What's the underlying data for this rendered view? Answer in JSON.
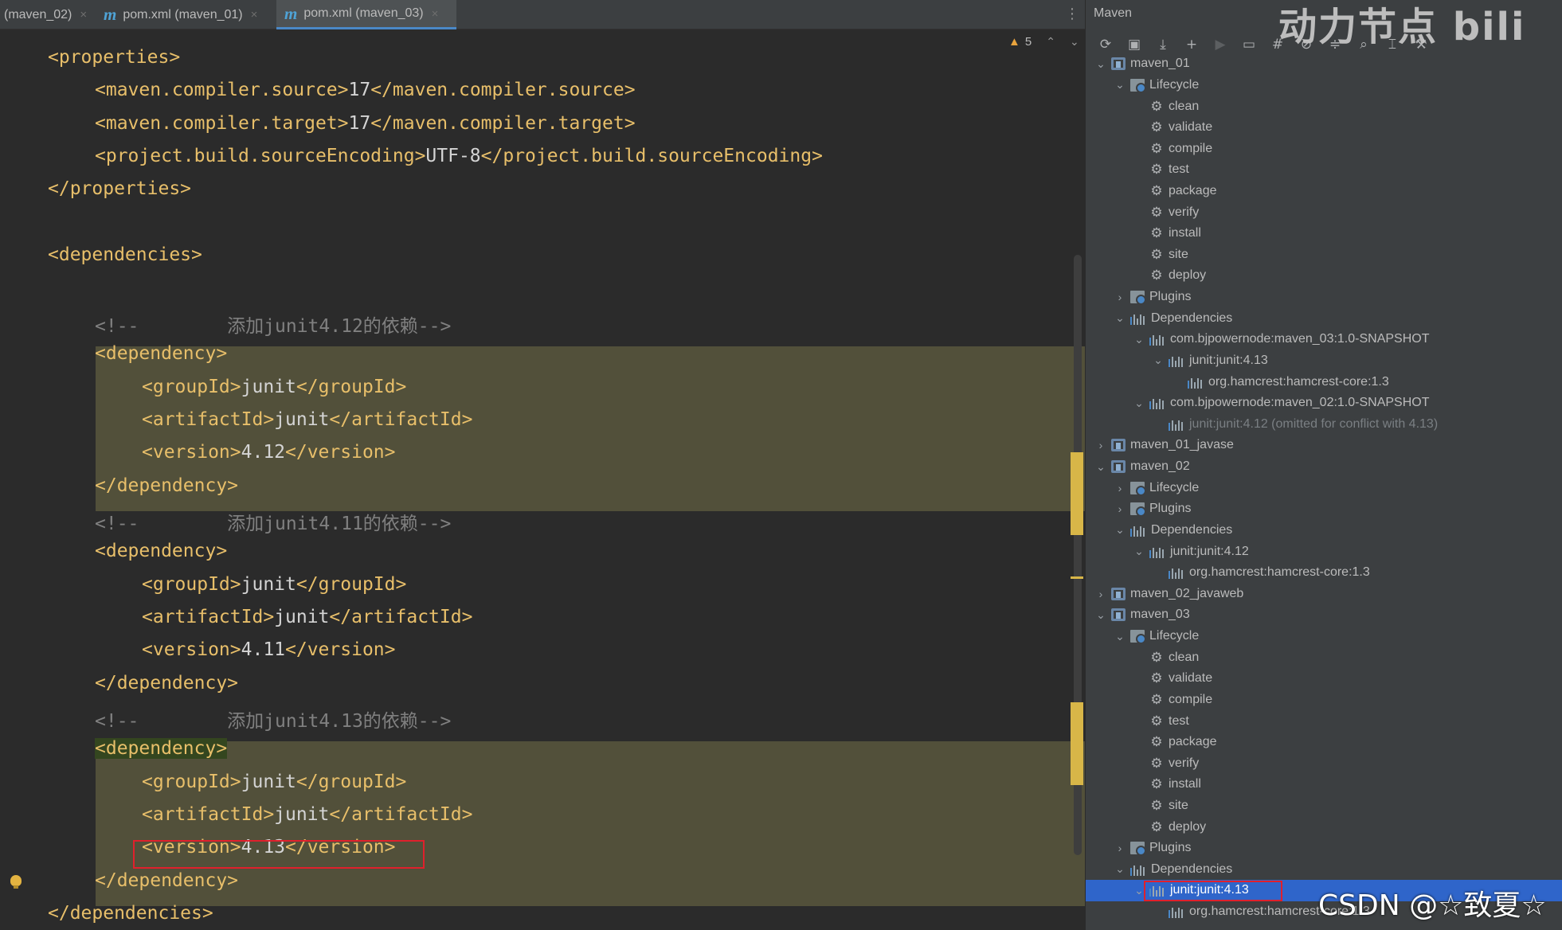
{
  "tabs": [
    {
      "label": "(maven_02)",
      "icon": "",
      "close": "×",
      "active": false
    },
    {
      "label": "pom.xml (maven_01)",
      "icon": "m",
      "close": "×",
      "active": false
    },
    {
      "label": "pom.xml (maven_03)",
      "icon": "m",
      "close": "×",
      "active": true
    }
  ],
  "editor": {
    "warnings_count": "5",
    "lines": [
      [
        {
          "t": "tag",
          "s": "<properties>"
        }
      ],
      [
        {
          "t": "tag",
          "s": "<maven.compiler.source>"
        },
        {
          "t": "txt",
          "s": "17"
        },
        {
          "t": "tag",
          "s": "</maven.compiler.source>"
        }
      ],
      [
        {
          "t": "tag",
          "s": "<maven.compiler.target>"
        },
        {
          "t": "txt",
          "s": "17"
        },
        {
          "t": "tag",
          "s": "</maven.compiler.target>"
        }
      ],
      [
        {
          "t": "tag",
          "s": "<project.build.sourceEncoding>"
        },
        {
          "t": "txt",
          "s": "UTF-8"
        },
        {
          "t": "tag",
          "s": "</project.build.sourceEncoding>"
        }
      ],
      [
        {
          "t": "tag",
          "s": "</properties>"
        }
      ],
      [],
      [
        {
          "t": "tag",
          "s": "<dependencies>"
        }
      ],
      [],
      [
        {
          "t": "cmt",
          "s": "<!--        添加junit4.12的依赖-->"
        }
      ],
      [
        {
          "t": "tag",
          "s": "<dependency>"
        }
      ],
      [
        {
          "t": "tag",
          "s": "<groupId>"
        },
        {
          "t": "txt",
          "s": "junit"
        },
        {
          "t": "tag",
          "s": "</groupId>"
        }
      ],
      [
        {
          "t": "tag",
          "s": "<artifactId>"
        },
        {
          "t": "txt",
          "s": "junit"
        },
        {
          "t": "tag",
          "s": "</artifactId>"
        }
      ],
      [
        {
          "t": "tag",
          "s": "<version>"
        },
        {
          "t": "txt",
          "s": "4.12"
        },
        {
          "t": "tag",
          "s": "</version>"
        }
      ],
      [
        {
          "t": "tag",
          "s": "</dependency>"
        }
      ],
      [
        {
          "t": "cmt",
          "s": "<!--        添加junit4.11的依赖-->"
        }
      ],
      [
        {
          "t": "tag",
          "s": "<dependency>"
        }
      ],
      [
        {
          "t": "tag",
          "s": "<groupId>"
        },
        {
          "t": "txt",
          "s": "junit"
        },
        {
          "t": "tag",
          "s": "</groupId>"
        }
      ],
      [
        {
          "t": "tag",
          "s": "<artifactId>"
        },
        {
          "t": "txt",
          "s": "junit"
        },
        {
          "t": "tag",
          "s": "</artifactId>"
        }
      ],
      [
        {
          "t": "tag",
          "s": "<version>"
        },
        {
          "t": "txt",
          "s": "4.11"
        },
        {
          "t": "tag",
          "s": "</version>"
        }
      ],
      [
        {
          "t": "tag",
          "s": "</dependency>"
        }
      ],
      [
        {
          "t": "cmt",
          "s": "<!--        添加junit4.13的依赖-->"
        }
      ],
      [
        {
          "t": "tag",
          "s": "<dependency>"
        }
      ],
      [
        {
          "t": "tag",
          "s": "<groupId>"
        },
        {
          "t": "txt",
          "s": "junit"
        },
        {
          "t": "tag",
          "s": "</groupId>"
        }
      ],
      [
        {
          "t": "tag",
          "s": "<artifactId>"
        },
        {
          "t": "txt",
          "s": "junit"
        },
        {
          "t": "tag",
          "s": "</artifactId>"
        }
      ],
      [
        {
          "t": "tag",
          "s": "<version>"
        },
        {
          "t": "txt",
          "s": "4.13"
        },
        {
          "t": "tag",
          "s": "</version>"
        }
      ],
      [
        {
          "t": "tag",
          "s": "</dependency>"
        }
      ],
      [
        {
          "t": "tag",
          "s": "</dependencies>"
        }
      ]
    ]
  },
  "maven": {
    "title": "Maven",
    "toolbar": [
      {
        "icon": "reload-icon",
        "glyph": "⟳"
      },
      {
        "icon": "add-folder-icon",
        "glyph": "▣"
      },
      {
        "icon": "download-icon",
        "glyph": "⤓"
      },
      {
        "icon": "add-icon",
        "glyph": "+"
      },
      {
        "icon": "run-icon",
        "glyph": "▶"
      },
      {
        "icon": "execute-goal-icon",
        "glyph": "▭"
      },
      {
        "icon": "toggle-offline-icon",
        "glyph": "#"
      },
      {
        "icon": "skip-tests-icon",
        "glyph": "⊘"
      },
      {
        "icon": "collapse-all-icon",
        "glyph": "≑"
      },
      {
        "icon": "show-dependencies-icon",
        "glyph": "⌕"
      },
      {
        "icon": "expand-icon",
        "glyph": "⌶"
      },
      {
        "icon": "settings-icon",
        "glyph": "⚒"
      }
    ],
    "tree": [
      {
        "label": "maven_01",
        "icon": "mod",
        "arrow": "⌄",
        "sel": false
      },
      {
        "label": "Lifecycle",
        "icon": "folder",
        "arrow": "⌄",
        "sel": false
      },
      {
        "label": "clean",
        "icon": "gear",
        "arrow": "",
        "sel": false
      },
      {
        "label": "validate",
        "icon": "gear",
        "arrow": "",
        "sel": false
      },
      {
        "label": "compile",
        "icon": "gear",
        "arrow": "",
        "sel": false
      },
      {
        "label": "test",
        "icon": "gear",
        "arrow": "",
        "sel": false
      },
      {
        "label": "package",
        "icon": "gear",
        "arrow": "",
        "sel": false
      },
      {
        "label": "verify",
        "icon": "gear",
        "arrow": "",
        "sel": false
      },
      {
        "label": "install",
        "icon": "gear",
        "arrow": "",
        "sel": false
      },
      {
        "label": "site",
        "icon": "gear",
        "arrow": "",
        "sel": false
      },
      {
        "label": "deploy",
        "icon": "gear",
        "arrow": "",
        "sel": false
      },
      {
        "label": "Plugins",
        "icon": "folder",
        "arrow": "›",
        "sel": false
      },
      {
        "label": "Dependencies",
        "icon": "lib",
        "arrow": "⌄",
        "sel": false
      },
      {
        "label": "com.bjpowernode:maven_03:1.0-SNAPSHOT",
        "icon": "lib",
        "arrow": "⌄",
        "sel": false
      },
      {
        "label": "junit:junit:4.13",
        "icon": "lib",
        "arrow": "⌄",
        "sel": false
      },
      {
        "label": "org.hamcrest:hamcrest-core:1.3",
        "icon": "lib",
        "arrow": "",
        "sel": false
      },
      {
        "label": "com.bjpowernode:maven_02:1.0-SNAPSHOT",
        "icon": "lib",
        "arrow": "⌄",
        "sel": false
      },
      {
        "label": "junit:junit:4.12 (omitted for conflict with 4.13)",
        "icon": "lib",
        "arrow": "",
        "sel": false,
        "omit": true
      },
      {
        "label": "maven_01_javase",
        "icon": "mod",
        "arrow": "›",
        "sel": false
      },
      {
        "label": "maven_02",
        "icon": "mod",
        "arrow": "⌄",
        "sel": false
      },
      {
        "label": "Lifecycle",
        "icon": "folder",
        "arrow": "›",
        "sel": false
      },
      {
        "label": "Plugins",
        "icon": "folder",
        "arrow": "›",
        "sel": false
      },
      {
        "label": "Dependencies",
        "icon": "lib",
        "arrow": "⌄",
        "sel": false
      },
      {
        "label": "junit:junit:4.12",
        "icon": "lib",
        "arrow": "⌄",
        "sel": false
      },
      {
        "label": "org.hamcrest:hamcrest-core:1.3",
        "icon": "lib",
        "arrow": "",
        "sel": false
      },
      {
        "label": "maven_02_javaweb",
        "icon": "mod",
        "arrow": "›",
        "sel": false
      },
      {
        "label": "maven_03",
        "icon": "mod",
        "arrow": "⌄",
        "sel": false
      },
      {
        "label": "Lifecycle",
        "icon": "folder",
        "arrow": "⌄",
        "sel": false
      },
      {
        "label": "clean",
        "icon": "gear",
        "arrow": "",
        "sel": false
      },
      {
        "label": "validate",
        "icon": "gear",
        "arrow": "",
        "sel": false
      },
      {
        "label": "compile",
        "icon": "gear",
        "arrow": "",
        "sel": false
      },
      {
        "label": "test",
        "icon": "gear",
        "arrow": "",
        "sel": false
      },
      {
        "label": "package",
        "icon": "gear",
        "arrow": "",
        "sel": false
      },
      {
        "label": "verify",
        "icon": "gear",
        "arrow": "",
        "sel": false
      },
      {
        "label": "install",
        "icon": "gear",
        "arrow": "",
        "sel": false
      },
      {
        "label": "site",
        "icon": "gear",
        "arrow": "",
        "sel": false
      },
      {
        "label": "deploy",
        "icon": "gear",
        "arrow": "",
        "sel": false
      },
      {
        "label": "Plugins",
        "icon": "folder",
        "arrow": "›",
        "sel": false
      },
      {
        "label": "Dependencies",
        "icon": "lib",
        "arrow": "⌄",
        "sel": false
      },
      {
        "label": "junit:junit:4.13",
        "icon": "lib",
        "arrow": "⌄",
        "sel": true
      },
      {
        "label": "org.hamcrest:hamcrest-core:1.3",
        "icon": "lib",
        "arrow": "",
        "sel": false
      }
    ]
  },
  "watermarks": {
    "top": "动力节点 bili",
    "bottom": "CSDN @☆致夏☆"
  },
  "colors": {
    "xml_tag": "#e8bf6a",
    "comment": "#808080",
    "highlight": "#52503a",
    "selection": "#2f65ca",
    "annotation_box": "#e0202c"
  }
}
